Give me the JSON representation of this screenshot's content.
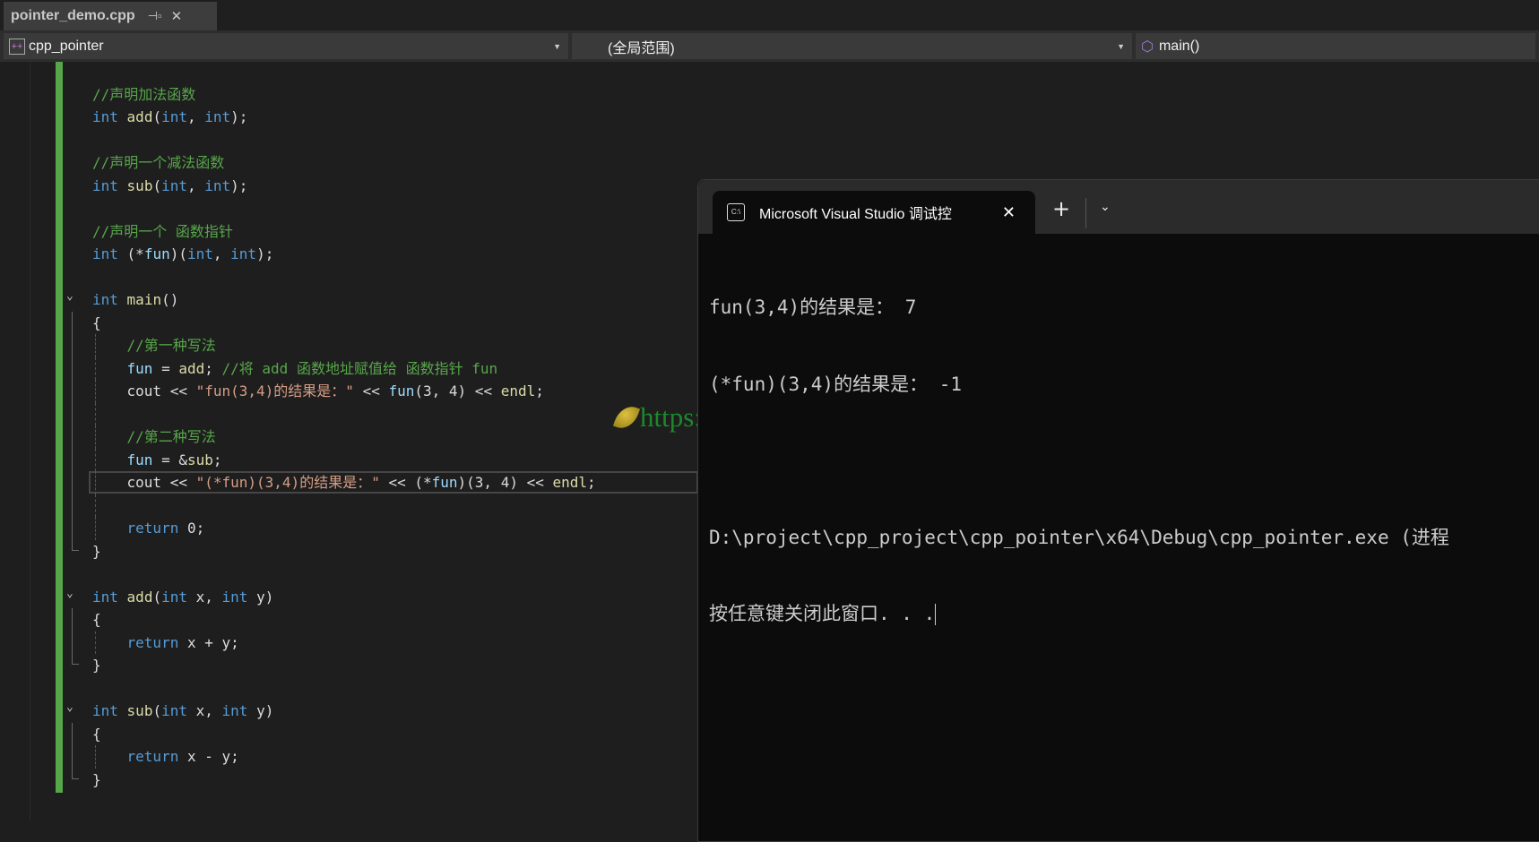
{
  "tab": {
    "filename": "pointer_demo.cpp",
    "pin_icon": "pin-icon",
    "close_icon": "close-icon"
  },
  "navbar": {
    "project": "cpp_pointer",
    "scope": "(全局范围)",
    "member": "main()"
  },
  "code": [
    [],
    [
      [
        "cm",
        "//声明加法函数"
      ]
    ],
    [
      [
        "kw",
        "int"
      ],
      [
        "id",
        " "
      ],
      [
        "fn",
        "add"
      ],
      [
        "id",
        "("
      ],
      [
        "kw",
        "int"
      ],
      [
        "id",
        ", "
      ],
      [
        "kw",
        "int"
      ],
      [
        "id",
        ");"
      ]
    ],
    [],
    [
      [
        "cm",
        "//声明一个减法函数"
      ]
    ],
    [
      [
        "kw",
        "int"
      ],
      [
        "id",
        " "
      ],
      [
        "fn",
        "sub"
      ],
      [
        "id",
        "("
      ],
      [
        "kw",
        "int"
      ],
      [
        "id",
        ", "
      ],
      [
        "kw",
        "int"
      ],
      [
        "id",
        ");"
      ]
    ],
    [],
    [
      [
        "cm",
        "//声明一个 函数指针"
      ]
    ],
    [
      [
        "kw",
        "int"
      ],
      [
        "id",
        " (*"
      ],
      [
        "var",
        "fun"
      ],
      [
        "id",
        ")("
      ],
      [
        "kw",
        "int"
      ],
      [
        "id",
        ", "
      ],
      [
        "kw",
        "int"
      ],
      [
        "id",
        ");"
      ]
    ],
    [],
    [
      [
        "kw",
        "int"
      ],
      [
        "id",
        " "
      ],
      [
        "fn",
        "main"
      ],
      [
        "id",
        "()"
      ]
    ],
    [
      [
        "id",
        "{"
      ]
    ],
    [
      [
        "id",
        "    "
      ],
      [
        "cm",
        "//第一种写法"
      ]
    ],
    [
      [
        "id",
        "    "
      ],
      [
        "var",
        "fun"
      ],
      [
        "id",
        " = "
      ],
      [
        "fn",
        "add"
      ],
      [
        "id",
        "; "
      ],
      [
        "cm",
        "//将 add 函数地址赋值给 函数指针 fun"
      ]
    ],
    [
      [
        "id",
        "    cout << "
      ],
      [
        "st",
        "\"fun(3,4)的结果是：\""
      ],
      [
        "id",
        " << "
      ],
      [
        "var",
        "fun"
      ],
      [
        "id",
        "(3, 4) << "
      ],
      [
        "fn",
        "endl"
      ],
      [
        "id",
        ";"
      ]
    ],
    [],
    [
      [
        "id",
        "    "
      ],
      [
        "cm",
        "//第二种写法"
      ]
    ],
    [
      [
        "id",
        "    "
      ],
      [
        "var",
        "fun"
      ],
      [
        "id",
        " = &"
      ],
      [
        "fn",
        "sub"
      ],
      [
        "id",
        ";"
      ]
    ],
    [
      [
        "id",
        "    cout << "
      ],
      [
        "st",
        "\"(*fun)(3,4)的结果是：\""
      ],
      [
        "id",
        " << (*"
      ],
      [
        "var",
        "fun"
      ],
      [
        "id",
        ")(3, 4) << "
      ],
      [
        "fn",
        "endl"
      ],
      [
        "id",
        ";"
      ]
    ],
    [],
    [
      [
        "id",
        "    "
      ],
      [
        "kw",
        "return"
      ],
      [
        "id",
        " 0;"
      ]
    ],
    [
      [
        "id",
        "}"
      ]
    ],
    [],
    [
      [
        "kw",
        "int"
      ],
      [
        "id",
        " "
      ],
      [
        "fn",
        "add"
      ],
      [
        "id",
        "("
      ],
      [
        "kw",
        "int"
      ],
      [
        "id",
        " x, "
      ],
      [
        "kw",
        "int"
      ],
      [
        "id",
        " y)"
      ]
    ],
    [
      [
        "id",
        "{"
      ]
    ],
    [
      [
        "id",
        "    "
      ],
      [
        "kw",
        "return"
      ],
      [
        "id",
        " x + y;"
      ]
    ],
    [
      [
        "id",
        "}"
      ]
    ],
    [],
    [
      [
        "kw",
        "int"
      ],
      [
        "id",
        " "
      ],
      [
        "fn",
        "sub"
      ],
      [
        "id",
        "("
      ],
      [
        "kw",
        "int"
      ],
      [
        "id",
        " x, "
      ],
      [
        "kw",
        "int"
      ],
      [
        "id",
        " y)"
      ]
    ],
    [
      [
        "id",
        "{"
      ]
    ],
    [
      [
        "id",
        "    "
      ],
      [
        "kw",
        "return"
      ],
      [
        "id",
        " x - y;"
      ]
    ],
    [
      [
        "id",
        "}"
      ]
    ]
  ],
  "console": {
    "tab_title": "Microsoft Visual Studio 调试控",
    "icon": "terminal-icon",
    "lines": [
      "fun(3,4)的结果是： 7",
      "(*fun)(3,4)的结果是： -1",
      "",
      "D:\\project\\cpp_project\\cpp_pointer\\x64\\Debug\\cpp_pointer.exe (进程",
      "按任意键关闭此窗口. . ."
    ]
  },
  "watermark": "https://qiucode.cn",
  "colors": {
    "keyword": "#569cd6",
    "comment": "#57a64a",
    "string": "#d69d85",
    "function": "#dcdcaa",
    "change_bar": "#57a64a"
  }
}
